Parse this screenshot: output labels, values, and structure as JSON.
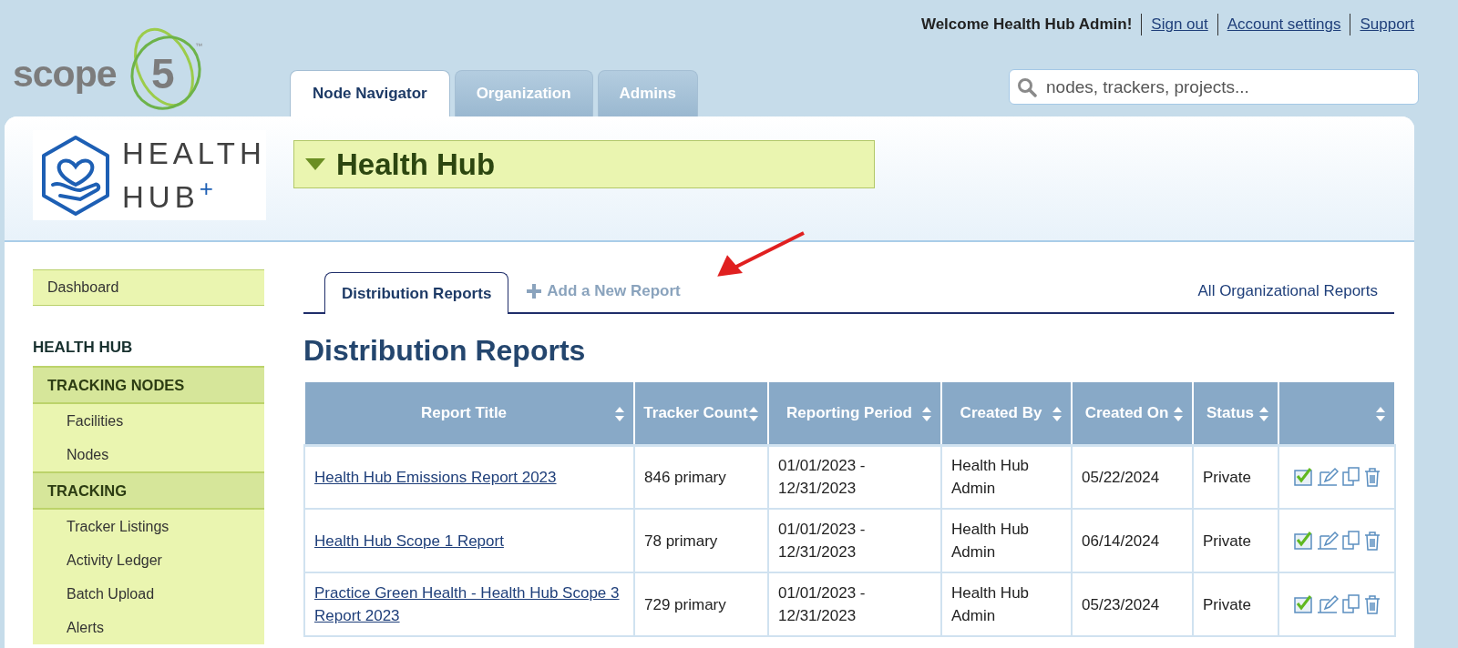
{
  "header": {
    "logo_text": "scope",
    "logo_digit": "5",
    "logo_mark": "™",
    "welcome": "Welcome Health Hub Admin!",
    "links": [
      "Sign out",
      "Account settings",
      "Support"
    ]
  },
  "tabs": [
    {
      "label": "Node Navigator",
      "selected": true
    },
    {
      "label": "Organization",
      "selected": false
    },
    {
      "label": "Admins",
      "selected": false
    }
  ],
  "search": {
    "placeholder": "nodes, trackers, projects..."
  },
  "org": {
    "logo_line_1": "HEALTH",
    "logo_line_2": "HUB",
    "logo_plus": "+",
    "title": "Health Hub",
    "expanded": true
  },
  "sidebar": {
    "top_item": "Dashboard",
    "heading": "HEALTH HUB",
    "sections": [
      {
        "title": "TRACKING NODES",
        "items": [
          "Facilities",
          "Nodes"
        ]
      },
      {
        "title": "TRACKING",
        "items": [
          "Tracker Listings",
          "Activity Ledger",
          "Batch Upload",
          "Alerts"
        ]
      }
    ]
  },
  "report_tabs": [
    {
      "label": "Distribution Reports",
      "kind": "tab",
      "selected": true
    },
    {
      "label": "Add a New Report",
      "kind": "add",
      "selected": false
    }
  ],
  "all_reports_link": "All Organizational Reports",
  "annotation": {
    "arrow": true
  },
  "page_title": "Distribution Reports",
  "table": {
    "columns": [
      "Report Title",
      "Tracker Count",
      "Reporting Period",
      "Created By",
      "Created On",
      "Status",
      ""
    ],
    "rows": [
      {
        "title": "Health Hub Emissions Report 2023",
        "tracker_count": "846 primary",
        "period": "01/01/2023 - 12/31/2023",
        "created_by": "Health Hub Admin",
        "created_on": "05/22/2024",
        "status": "Private"
      },
      {
        "title": "Health Hub Scope 1 Report",
        "tracker_count": "78 primary",
        "period": "01/01/2023 - 12/31/2023",
        "created_by": "Health Hub Admin",
        "created_on": "06/14/2024",
        "status": "Private"
      },
      {
        "title": "Practice Green Health - Health Hub Scope 3 Report 2023",
        "tracker_count": "729 primary",
        "period": "01/01/2023 - 12/31/2023",
        "created_by": "Health Hub Admin",
        "created_on": "05/23/2024",
        "status": "Private"
      }
    ]
  }
}
